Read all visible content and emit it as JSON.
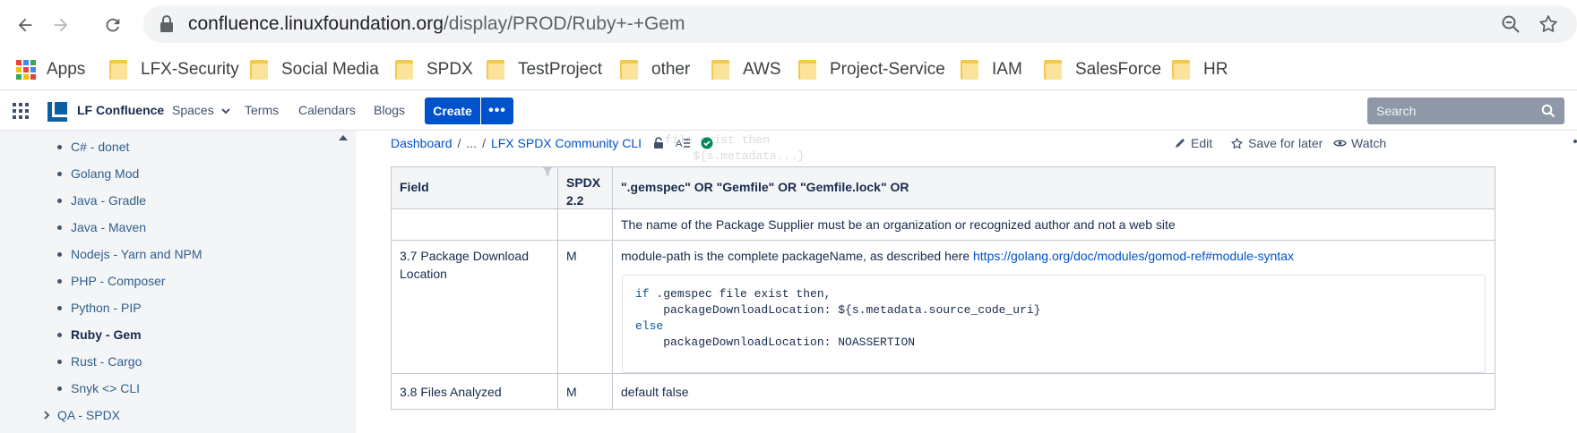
{
  "browser": {
    "url_host": "confluence.linuxfoundation.org",
    "url_path": "/display/PROD/Ruby+-+Gem",
    "bookmarks": [
      {
        "label": "Apps",
        "icon": "apps-grid-icon"
      },
      {
        "label": "LFX-Security",
        "icon": "folder-icon"
      },
      {
        "label": "Social Media",
        "icon": "folder-icon"
      },
      {
        "label": "SPDX",
        "icon": "folder-icon"
      },
      {
        "label": "TestProject",
        "icon": "folder-icon"
      },
      {
        "label": "other",
        "icon": "folder-icon"
      },
      {
        "label": "AWS",
        "icon": "folder-icon"
      },
      {
        "label": "Project-Service",
        "icon": "folder-icon"
      },
      {
        "label": "IAM",
        "icon": "folder-icon"
      },
      {
        "label": "SalesForce",
        "icon": "folder-icon"
      },
      {
        "label": "HR",
        "icon": "folder-icon"
      }
    ]
  },
  "header": {
    "app_name": "LF Confluence",
    "nav": [
      "Spaces",
      "Terms",
      "Calendars",
      "Blogs"
    ],
    "create_label": "Create",
    "more_label": "•••",
    "search_placeholder": "Search"
  },
  "sidebar": {
    "items": [
      {
        "label": "C# - donet",
        "active": false
      },
      {
        "label": "Golang Mod",
        "active": false
      },
      {
        "label": "Java - Gradle",
        "active": false
      },
      {
        "label": "Java - Maven",
        "active": false
      },
      {
        "label": "Nodejs - Yarn and NPM",
        "active": false
      },
      {
        "label": "PHP - Composer",
        "active": false
      },
      {
        "label": "Python - PIP",
        "active": false
      },
      {
        "label": "Ruby - Gem",
        "active": true
      },
      {
        "label": "Rust - Cargo",
        "active": false
      },
      {
        "label": "Snyk <> CLI",
        "active": false
      }
    ],
    "qa_label": "QA - SPDX"
  },
  "breadcrumb": {
    "dashboard": "Dashboard",
    "ellipsis": "...",
    "page": "LFX SPDX Community CLI"
  },
  "ghost_text": "file exist then\n    ${s.metadata...}",
  "actions": {
    "edit": "Edit",
    "save_for_later": "Save for later",
    "watch": "Watch"
  },
  "table": {
    "headers": [
      "Field",
      "SPDX 2.2",
      "\".gemspec\" OR \"Gemfile\" OR \"Gemfile.lock\" OR"
    ],
    "supplier_note": "The name of the Package Supplier must be an organization or recognized author and not a web site",
    "row_download": {
      "field": "3.7   Package Download Location",
      "spdx": "M",
      "desc": "module-path is the complete packageName, as described here ",
      "link": "https://golang.org/doc/modules/gomod-ref#module-syntax",
      "code": [
        {
          "kw": "if",
          "text": " .gemspec file exist then,"
        },
        {
          "kw": "",
          "text": "    packageDownloadLocation: ${s.metadata.source_code_uri}"
        },
        {
          "kw": "else",
          "text": ""
        },
        {
          "kw": "",
          "text": "    packageDownloadLocation: NOASSERTION"
        }
      ]
    },
    "row_files": {
      "field": "3.8  Files Analyzed",
      "spdx": "M",
      "desc": "default false"
    }
  },
  "colors": {
    "accent": "#0052cc",
    "sidebar_bg": "#f4f5f7",
    "search_bg": "#8e98a7"
  }
}
